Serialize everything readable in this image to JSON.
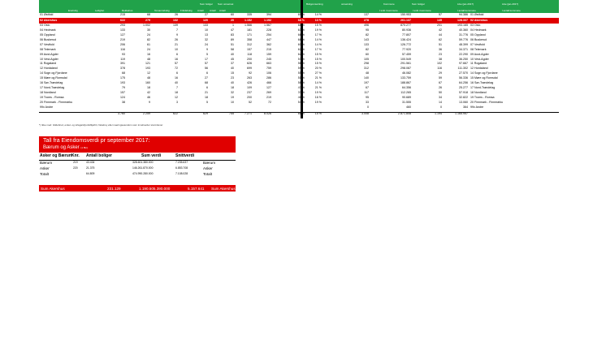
{
  "header": {
    "col_labels": [
      "Enebolig",
      "Leilighet",
      "Rekkehus",
      "Tomannsbolig",
      "Fritidsbolig"
    ],
    "sum_label_1": "Sum boliger",
    "sum_label_2": "Sum omsetnet",
    "sub_1": "Antall",
    "sub_2": "Antall",
    "sub_3": "Antall",
    "right_1": "Boligomsetning",
    "right_2": "omsetning",
    "right_3": "Kommune",
    "right_4": "Sum boliger",
    "right_5": "Like (jan-2017)",
    "right_6": "Like (jan-2017)",
    "right_sub_1": "I snitt i kommune",
    "right_sub_2": "I snitt i kommune",
    "right_sub_3": "I antall kommune",
    "right_sub_4": "I antall kommune"
  },
  "rows": [
    {
      "name": "01 Østfold",
      "v": [
        "215",
        "68",
        "26",
        "27",
        "60",
        "335",
        "394"
      ],
      "p": [
        "65 %",
        "14 %"
      ],
      "w": [
        "137",
        "150.953",
        "57",
        "94.386"
      ],
      "n2": "01 Østfold"
    },
    {
      "name": "02 Akershus",
      "v": [
        "622",
        "279",
        "132",
        "120",
        "20",
        "1.152",
        "1.192"
      ],
      "p": [
        "68 %",
        "13 %"
      ],
      "w": [
        "278",
        "261.137",
        "145",
        "128.337"
      ],
      "n2": "02 Akershus",
      "red": true
    },
    {
      "name": "03 Oslo",
      "v": [
        "293",
        "1.002",
        "139",
        "133",
        "1",
        "1.566",
        "1.567"
      ],
      "p": [
        "68 %",
        "15 %"
      ],
      "w": [
        "496",
        "870.277",
        "201",
        "193.165"
      ],
      "n2": "03 Oslo"
    },
    {
      "name": "04 Hedmark",
      "v": [
        "133",
        "30",
        "7",
        "10",
        "47",
        "181",
        "228"
      ],
      "p": [
        "63 %",
        "19 %"
      ],
      "w": [
        "95",
        "80.936",
        "42",
        "40.360"
      ],
      "n2": "04 Hedmark"
    },
    {
      "name": "05 Oppland",
      "v": [
        "127",
        "24",
        "9",
        "13",
        "83",
        "171",
        "254"
      ],
      "p": [
        "66 %",
        "17 %"
      ],
      "w": [
        "82",
        "77.807",
        "44",
        "31.776"
      ],
      "n2": "05 Oppland"
    },
    {
      "name": "06 Buskerud",
      "v": [
        "219",
        "82",
        "26",
        "32",
        "89",
        "358",
        "447"
      ],
      "p": [
        "68 %",
        "14 %"
      ],
      "w": [
        "143",
        "136.424",
        "62",
        "59.776"
      ],
      "n2": "06 Buskerud"
    },
    {
      "name": "07 Vestfold",
      "v": [
        "206",
        "61",
        "21",
        "24",
        "51",
        "312",
        "362"
      ],
      "p": [
        "60 %",
        "14 %"
      ],
      "w": [
        "133",
        "126.772",
        "51",
        "48.399"
      ],
      "n2": "07 Vestfold"
    },
    {
      "name": "08 Telemark",
      "v": [
        "116",
        "24",
        "10",
        "9",
        "58",
        "157",
        "215"
      ],
      "p": [
        "62 %",
        "17 %"
      ],
      "w": [
        "82",
        "77.920",
        "36",
        "34.371"
      ],
      "n2": "08 Telemark"
    },
    {
      "name": "09 Aust-Agder",
      "v": [
        "93",
        "16",
        "6",
        "5",
        "40",
        "118",
        "159"
      ],
      "p": [
        "62 %",
        "15 %"
      ],
      "w": [
        "60",
        "57.459",
        "23",
        "22.290"
      ],
      "n2": "09 Aust-Agder"
    },
    {
      "name": "10 Vest-Agder",
      "v": [
        "119",
        "48",
        "16",
        "17",
        "45",
        "200",
        "245"
      ],
      "p": [
        "57 %",
        "15 %"
      ],
      "w": [
        "105",
        "100.549",
        "38",
        "36.250"
      ],
      "n2": "10 Vest-Agder"
    },
    {
      "name": "11 Rogaland",
      "v": [
        "391",
        "121",
        "57",
        "57",
        "37",
        "626",
        "663"
      ],
      "p": [
        "56 %",
        "15 %"
      ],
      "w": [
        "298",
        "291.561",
        "102",
        "97.667"
      ],
      "n2": "11 Rogaland"
    },
    {
      "name": "12 Hordaland",
      "v": [
        "378",
        "193",
        "72",
        "56",
        "40",
        "699",
        "759"
      ],
      "p": [
        "59 %",
        "20 %"
      ],
      "w": [
        "312",
        "298.087",
        "116",
        "111.302"
      ],
      "n2": "12 Hordaland"
    },
    {
      "name": "14 Sogn og Fjordane",
      "v": [
        "68",
        "12",
        "6",
        "6",
        "15",
        "92",
        "106"
      ],
      "p": [
        "55 %",
        "27 %"
      ],
      "w": [
        "48",
        "46.082",
        "29",
        "27.570"
      ],
      "n2": "14 Sogn og Fjordane"
    },
    {
      "name": "15 Møre og Romsdal",
      "v": [
        "175",
        "48",
        "16",
        "27",
        "23",
        "263",
        "286"
      ],
      "p": [
        "51 %",
        "21 %"
      ],
      "w": [
        "140",
        "133.759",
        "59",
        "56.336"
      ],
      "n2": "15 Møre og Romsdal"
    },
    {
      "name": "16 Sør-Trøndelag",
      "v": [
        "193",
        "160",
        "40",
        "68",
        "40",
        "426",
        "466"
      ],
      "p": [
        "58 %",
        "14 %"
      ],
      "w": [
        "197",
        "188.867",
        "67",
        "64.256"
      ],
      "n2": "16 Sør-Trøndelag"
    },
    {
      "name": "17 Nord-Trøndelag",
      "v": [
        "79",
        "18",
        "7",
        "6",
        "18",
        "109",
        "127"
      ],
      "p": [
        "47 %",
        "21 %"
      ],
      "w": [
        "67",
        "64.356",
        "26",
        "25.277"
      ],
      "n2": "17 Nord-Trøndelag"
    },
    {
      "name": "18 Nordland",
      "v": [
        "157",
        "42",
        "18",
        "21",
        "32",
        "237",
        "269"
      ],
      "p": [
        "37 %",
        "19 %"
      ],
      "w": [
        "117",
        "112.265",
        "50",
        "57.918"
      ],
      "n2": "18 Nordland"
    },
    {
      "name": "19 Troms - Romsa",
      "v": [
        "124",
        "46",
        "12",
        "18",
        "19",
        "200",
        "219"
      ],
      "p": [
        "41 %",
        "16 %"
      ],
      "w": [
        "95",
        "90.689",
        "34",
        "32.822"
      ],
      "n2": "19 Troms - Romsa"
    },
    {
      "name": "20 Finnmark - Finnmárku",
      "v": [
        "38",
        "9",
        "3",
        "5",
        "10",
        "52",
        "72"
      ],
      "p": [
        "54 %",
        "19 %"
      ],
      "w": [
        "33",
        "31.555",
        "14",
        "13.060"
      ],
      "n2": "20 Finnmark - Finnmárku"
    },
    {
      "name": "99x Andre",
      "v": [
        "",
        "",
        "",
        "",
        "",
        "",
        ""
      ],
      "p": [
        "",
        ""
      ],
      "w": [
        "0",
        "460",
        "0",
        "364"
      ],
      "n2": "99x Andre"
    }
  ],
  "sum_row": {
    "v": [
      "3.760",
      "2.259",
      "622",
      "629",
      "755",
      "7.271",
      "8.026"
    ],
    "p": [
      "66 %",
      "15 %"
    ],
    "w": [
      "3.008",
      "2.871.808",
      "1.194",
      "1.165.957"
    ]
  },
  "footnote": "*) Ikke med: Glidebrud, enkel- og tofagarsfjordsfiljetfirt, fiskeboy eller naeringseiendom som innehavder stormilener",
  "block2": {
    "title": "Tall fra Eiendomsverdi pr september 2017:",
    "subtitle": "Bærum og Asker",
    "subtitle_small": "(1 ffkr)",
    "headers": [
      "Asker og Bærum",
      "Knr.",
      "Antall boliger",
      "Sum verdi",
      "Snittverdi"
    ],
    "rows": [
      {
        "name": "Bærum",
        "knr": "219",
        "antall": "43.434",
        "sum": "328.601.380.000",
        "snitt": "7.235.637",
        "name2": "Bærum"
      },
      {
        "name": "Asker",
        "knr": "220",
        "antall": "21.375",
        "sum": "146.261.870.000",
        "snitt": "6.853.708",
        "name2": "Asker"
      },
      {
        "name": "Totalt",
        "knr": "",
        "antall": "64.809",
        "sum": "474.990.280.000",
        "snitt": "7.108.028",
        "name2": "Totalt"
      }
    ],
    "sum": {
      "label": "Sum Akershus",
      "antall": "231.129",
      "sum": "1.190.505.390.000",
      "snitt": "5.157.641",
      "label2": "Sum Akershus"
    }
  }
}
